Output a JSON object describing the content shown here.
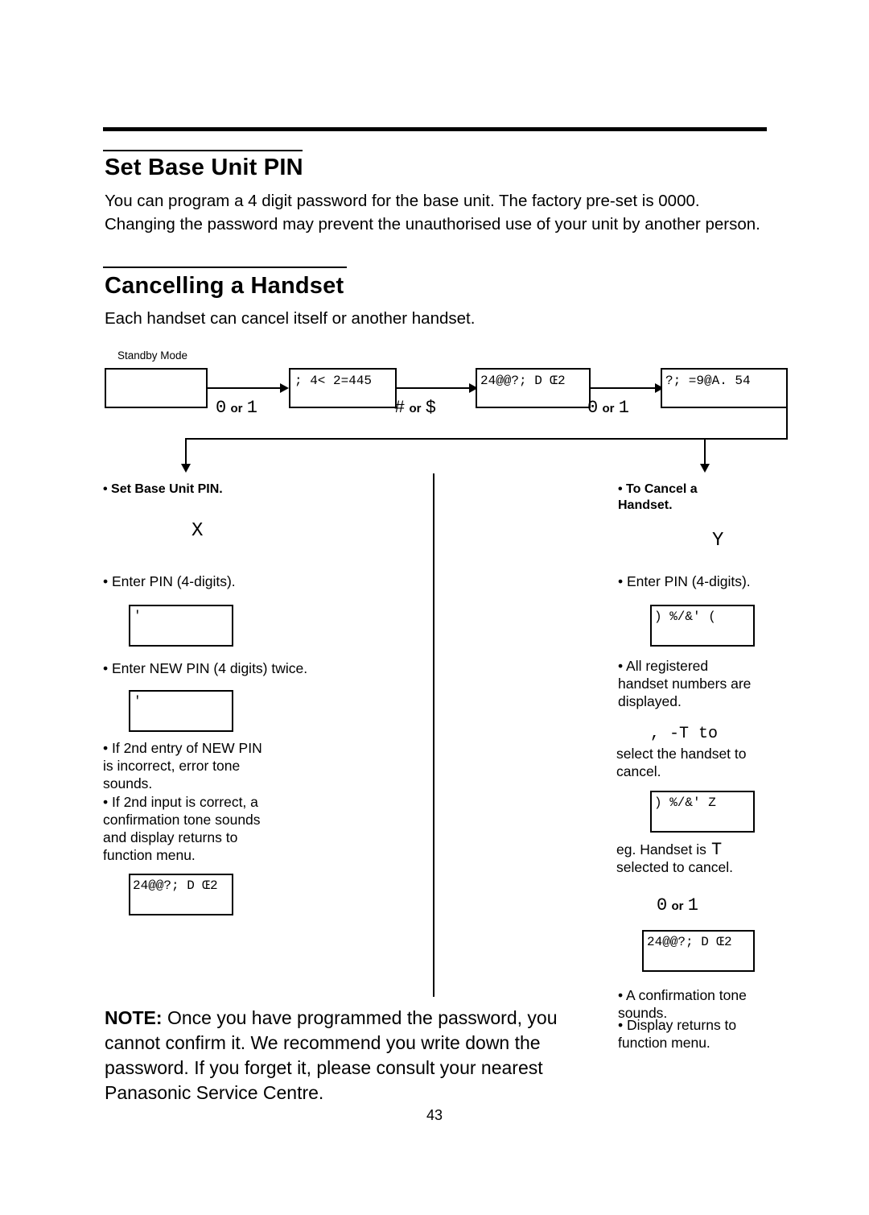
{
  "document": {
    "page_number": "43",
    "headings": {
      "set_base_unit_pin": "Set Base Unit PIN",
      "cancelling_a_handset": "Cancelling a Handset"
    },
    "paragraphs": {
      "intro_pin": "You can program a 4 digit password for the base unit. The factory pre-set is 0000. Changing the password may prevent the unauthorised use of your unit by another person.",
      "intro_cancel": "Each handset can cancel itself or another handset.",
      "note": "Once you have programmed the password, you cannot confirm it. We recommend you write down the password. If you forget it, please consult your nearest Panasonic Service Centre.",
      "note_label": "NOTE:"
    },
    "flow": {
      "standby_label": "Standby Mode",
      "screens": [
        {
          "name": "standby-screen",
          "text": ""
        },
        {
          "name": "function-screen",
          "text": "; 4< 2=445"
        },
        {
          "name": "base-unit-screen",
          "text": "24@@?; D Œ2"
        },
        {
          "name": "set-pin-screen",
          "text": "?; =9@A. 54"
        }
      ],
      "keys": [
        {
          "name": "key-step-1",
          "glyph": "0",
          "or": "or",
          "glyph2": "1"
        },
        {
          "name": "key-step-2",
          "glyph": "#",
          "or": "or",
          "glyph2": "$"
        },
        {
          "name": "key-step-3",
          "glyph": "0",
          "or": "or",
          "glyph2": "1"
        }
      ]
    },
    "left_column": {
      "branch_title": "• Set Base Unit PIN.",
      "branch_glyph": "X",
      "steps": [
        "• Enter PIN (4-digits).",
        "• Enter NEW PIN (4 digits) twice.",
        "• If 2nd entry of NEW PIN\n  is incorrect, error tone\n  sounds.",
        "• If 2nd input is correct, a\n  confirmation tone sounds\n  and display returns to\n  function menu."
      ],
      "screens": [
        {
          "name": "enter-pin-screen",
          "text": "'"
        },
        {
          "name": "enter-new-pin-screen",
          "text": "'"
        },
        {
          "name": "function-menu-screen",
          "text": "24@@?; D Œ2"
        }
      ]
    },
    "right_column": {
      "branch_title": "• To Cancel a\n  Handset.",
      "branch_glyph": "Y",
      "steps": [
        "• Enter PIN (4-digits).",
        "• All registered\n  handset numbers are\n  displayed.",
        "select the handset to\ncancel.",
        "eg. Handset      is\nselected to cancel.",
        "• A confirmation tone\n  sounds.",
        "• Display returns to\n  function menu."
      ],
      "inline_glyphs": {
        "select_keys": ",      -T      to",
        "handset_example": "T",
        "confirm_key_left": "0",
        "confirm_key_or": "or",
        "confirm_key_right": "1"
      },
      "screens": [
        {
          "name": "enter-pin-screen-right",
          "text": ")      %/&' ("
        },
        {
          "name": "handset-list-screen",
          "text": ")      %/&' Z"
        },
        {
          "name": "function-menu-screen-right",
          "text": "24@@?; D Œ2"
        }
      ]
    }
  }
}
